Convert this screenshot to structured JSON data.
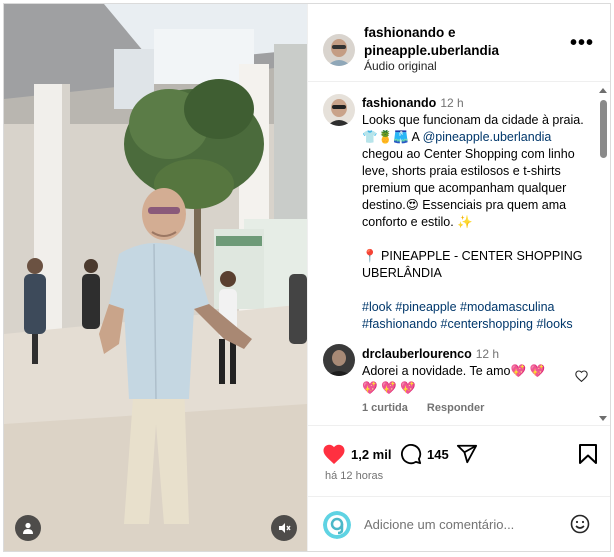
{
  "post": {
    "header": {
      "title": "fashionando e pineapple.uberlandia",
      "subtitle": "Áudio original",
      "more_icon": "more-horizontal-icon"
    },
    "caption": {
      "username": "fashionando",
      "time": "12 h",
      "line1": "Looks que funcionam da cidade à praia.",
      "line2_emoji": "👕🍍🩳",
      "line2_pre": " A ",
      "mention": "@pineapple.uberlandia",
      "line2_post": " chegou ao Center Shopping com linho leve, shorts praia estilosos e t-shirts premium que acompanham qualquer destino.",
      "line2_emoji2": "😍",
      "line2_end": " Essenciais pra quem ama conforto e estilo. ✨",
      "location": "📍 PINEAPPLE - CENTER SHOPPING UBERLÂNDIA",
      "hashtags": "#look #pineapple #modamasculina #fashionando #centershopping #looks"
    },
    "comment": {
      "username": "drclauberlourenco",
      "time": "12 h",
      "text": "Adorei a novidade. Te amo💖 💖 💖 💖 💖",
      "likes": "1 curtida",
      "reply": "Responder"
    },
    "actions": {
      "likes": "1,2 mil",
      "comments": "145",
      "time_ago": "há 12 horas"
    },
    "compose": {
      "placeholder": "Adicione um comentário..."
    }
  },
  "icons": {
    "like": "heart-filled-icon",
    "comment": "comment-icon",
    "share": "share-icon",
    "save": "bookmark-icon",
    "emoji": "emoji-icon",
    "user": "user-tag-icon",
    "mute": "muted-icon"
  },
  "colors": {
    "like_red": "#ff3040",
    "link_blue": "#00376b",
    "muted_text": "#737373"
  }
}
